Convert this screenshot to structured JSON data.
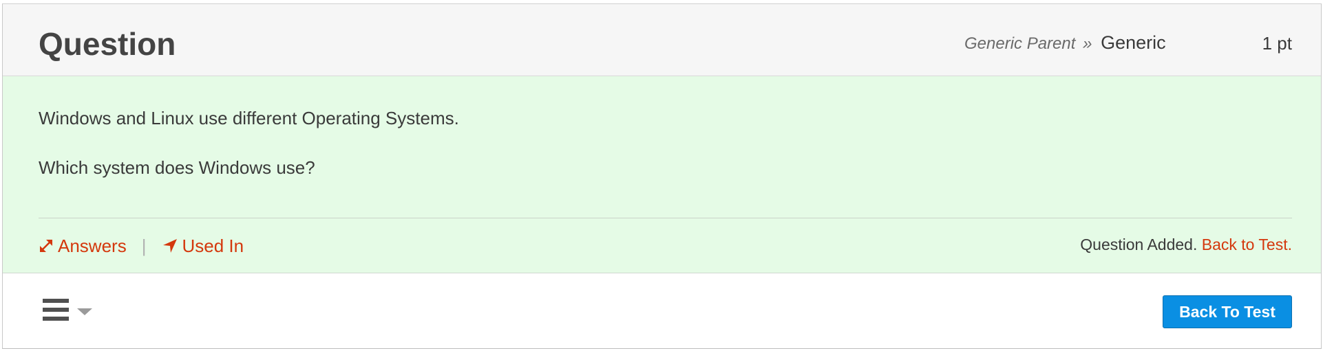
{
  "header": {
    "title": "Question",
    "breadcrumb": {
      "parent": "Generic Parent",
      "separator": "»",
      "current": "Generic"
    },
    "points": "1 pt"
  },
  "question": {
    "line1": "Windows and Linux use different Operating Systems.",
    "line2": "Which system does Windows use?"
  },
  "actions": {
    "answers_label": "Answers",
    "answers_icon": "expand-arrows-icon",
    "used_in_label": "Used In",
    "used_in_icon": "location-arrow-icon",
    "separator": "|"
  },
  "status": {
    "message": "Question Added.",
    "link": "Back to Test."
  },
  "footer": {
    "menu_icon": "hamburger-menu-icon",
    "dropdown_icon": "caret-down-icon",
    "back_button_label": "Back To Test"
  },
  "colors": {
    "accent_link": "#d4380d",
    "body_background": "#e5fbe6",
    "header_background": "#f6f6f6",
    "primary_button": "#0a8fe3"
  }
}
